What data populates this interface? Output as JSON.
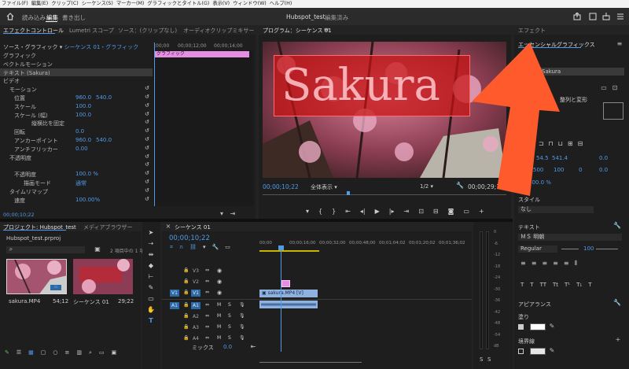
{
  "menubar": {
    "items": [
      "ファイル(F)",
      "編集(E)",
      "クリップ(C)",
      "シーケンス(S)",
      "マーカー(M)",
      "グラフィックとタイトル(G)",
      "表示(V)",
      "ウィンドウ(W)",
      "ヘルプ(H)"
    ]
  },
  "workspace": {
    "tabs": [
      "読み込み",
      "編集",
      "書き出し"
    ],
    "active_tab": "編集",
    "project_title": "Hubspot_test",
    "edit_status": "編集済み"
  },
  "effect_controls": {
    "tabs": [
      "エフェクトコントロール",
      "Lumetri スコープ",
      "ソース：(クリップなし)",
      "オーディオクリップミキサー"
    ],
    "source_label": "ソース・グラフィック",
    "sequence_label": "シーケンス 01・グラフィック",
    "timecodes": [
      ";00;00",
      "00;00;12;00",
      "00;00;14;00"
    ],
    "clip_label": "グラフィック",
    "rows": [
      {
        "label": "グラフィック",
        "value": "",
        "value2": ""
      },
      {
        "label": "ベクトルモーション",
        "value": "",
        "value2": ""
      },
      {
        "label": "テキスト (Sakura)",
        "value": "",
        "value2": ""
      },
      {
        "label": "ビデオ",
        "value": "",
        "value2": ""
      },
      {
        "label": "モーション",
        "value": "",
        "value2": ""
      },
      {
        "label": "位置",
        "value": "960.0",
        "value2": "540.0"
      },
      {
        "label": "スケール",
        "value": "100.0",
        "value2": ""
      },
      {
        "label": "スケール (幅)",
        "value": "100.0",
        "value2": ""
      },
      {
        "label": "縦横比を固定",
        "value": "",
        "value2": ""
      },
      {
        "label": "回転",
        "value": "0.0",
        "value2": ""
      },
      {
        "label": "アンカーポイント",
        "value": "960.0",
        "value2": "540.0"
      },
      {
        "label": "アンチフリッカー",
        "value": "0.00",
        "value2": ""
      },
      {
        "label": "不透明度",
        "value": "",
        "value2": ""
      },
      {
        "label": "",
        "value": "",
        "value2": ""
      },
      {
        "label": "不透明度",
        "value": "100.0 %",
        "value2": ""
      },
      {
        "label": "描画モード",
        "value": "通常",
        "value2": ""
      },
      {
        "label": "タイムリマップ",
        "value": "",
        "value2": ""
      },
      {
        "label": "速度",
        "value": "100.00%",
        "value2": ""
      }
    ],
    "timecode": "00;00;10;22"
  },
  "program_monitor": {
    "tab": "プログラム：シーケンス 01",
    "title_text": "Sakura",
    "timecode": "00;00;10;22",
    "zoom": "全体表示",
    "resolution": "1/2",
    "duration": "00;00;29;12"
  },
  "essential_graphics": {
    "panel_tab": "エフェクト",
    "title": "エッセンシャルグラフィックス",
    "layer_name": "Sakura",
    "align_label": "整列と変形",
    "values": [
      "54.5",
      "541.4",
      "0.0",
      "500",
      "100",
      "0",
      "0.0",
      "100.0 %"
    ],
    "style_label": "スタイル",
    "style_value": "なし",
    "text_label": "テキスト",
    "font": "ＭＳ 明朝",
    "font_style": "Regular",
    "font_size": "100",
    "appearance_label": "アピアランス",
    "fill_label": "塗り",
    "stroke_label": "境界線",
    "colors": {
      "accent": "#ff5a2b",
      "fill_swatch": "#ffffff"
    }
  },
  "project_panel": {
    "tabs": [
      "プロジェクト: Hubspot_test",
      "メディアブラウザー"
    ],
    "file_name": "Hubspot_test.prproj",
    "selection_info": "2 項目中の 1 項",
    "items": [
      {
        "name": "sakura.MP4",
        "duration": "54;12"
      },
      {
        "name": "シーケンス 01",
        "duration": "29;22"
      }
    ]
  },
  "timeline": {
    "tab": "シーケンス 01",
    "timecode": "00;00;10;22",
    "ruler_labels": [
      "00;00",
      "00;00;16;00",
      "00;00;32;00",
      "00;00;48;00",
      "00;01;04;02",
      "00;01;20;02",
      "00;01;36;02"
    ],
    "video_tracks": [
      "V3",
      "V2",
      "V1"
    ],
    "audio_tracks": [
      "A1",
      "A2",
      "A3",
      "A4"
    ],
    "track_target_v": "V1",
    "track_target_a": "A1",
    "mute_label": "M",
    "solo_label": "S",
    "clip_video": "sakura.MP4 [V]",
    "mix_label": "ミックス",
    "mix_value": "0.0"
  },
  "audio_meter": {
    "scale": [
      "0",
      "-6",
      "-12",
      "-18",
      "-24",
      "-30",
      "-36",
      "-42",
      "-48",
      "-54",
      "dB"
    ],
    "solo_labels": [
      "S",
      "S"
    ]
  }
}
